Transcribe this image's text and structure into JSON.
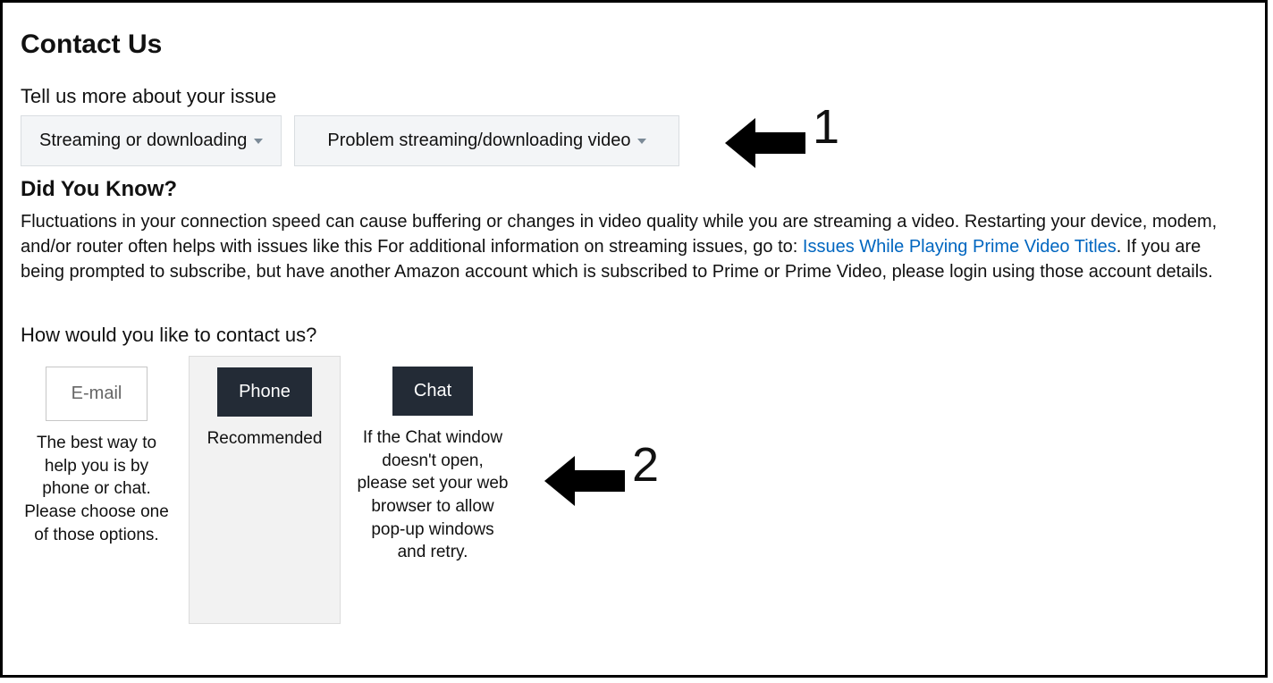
{
  "page_title": "Contact Us",
  "issue_prompt": "Tell us more about your issue",
  "dropdown1": "Streaming or downloading",
  "dropdown2": "Problem streaming/downloading video",
  "did_you_know_heading": "Did You Know?",
  "did_you_know_text1": "Fluctuations in your connection speed can cause buffering or changes in video quality while you are streaming a video. Restarting your device, modem, and/or router often helps with issues like this For additional information on streaming issues, go to: ",
  "did_you_know_link": "Issues While Playing Prime Video Titles",
  "did_you_know_text2": ". If you are being prompted to subscribe, but have another Amazon account which is subscribed to Prime or Prime Video, please login using those account details.",
  "contact_options_heading": "How would you like to contact us?",
  "email_label": "E-mail",
  "email_desc": "The best way to help you is by phone or chat. Please choose one of those options.",
  "phone_label": "Phone",
  "phone_desc": "Recommended",
  "chat_label": "Chat",
  "chat_desc": "If the Chat window doesn't open, please set your web browser to allow pop-up windows and retry.",
  "annotation1": "1",
  "annotation2": "2"
}
